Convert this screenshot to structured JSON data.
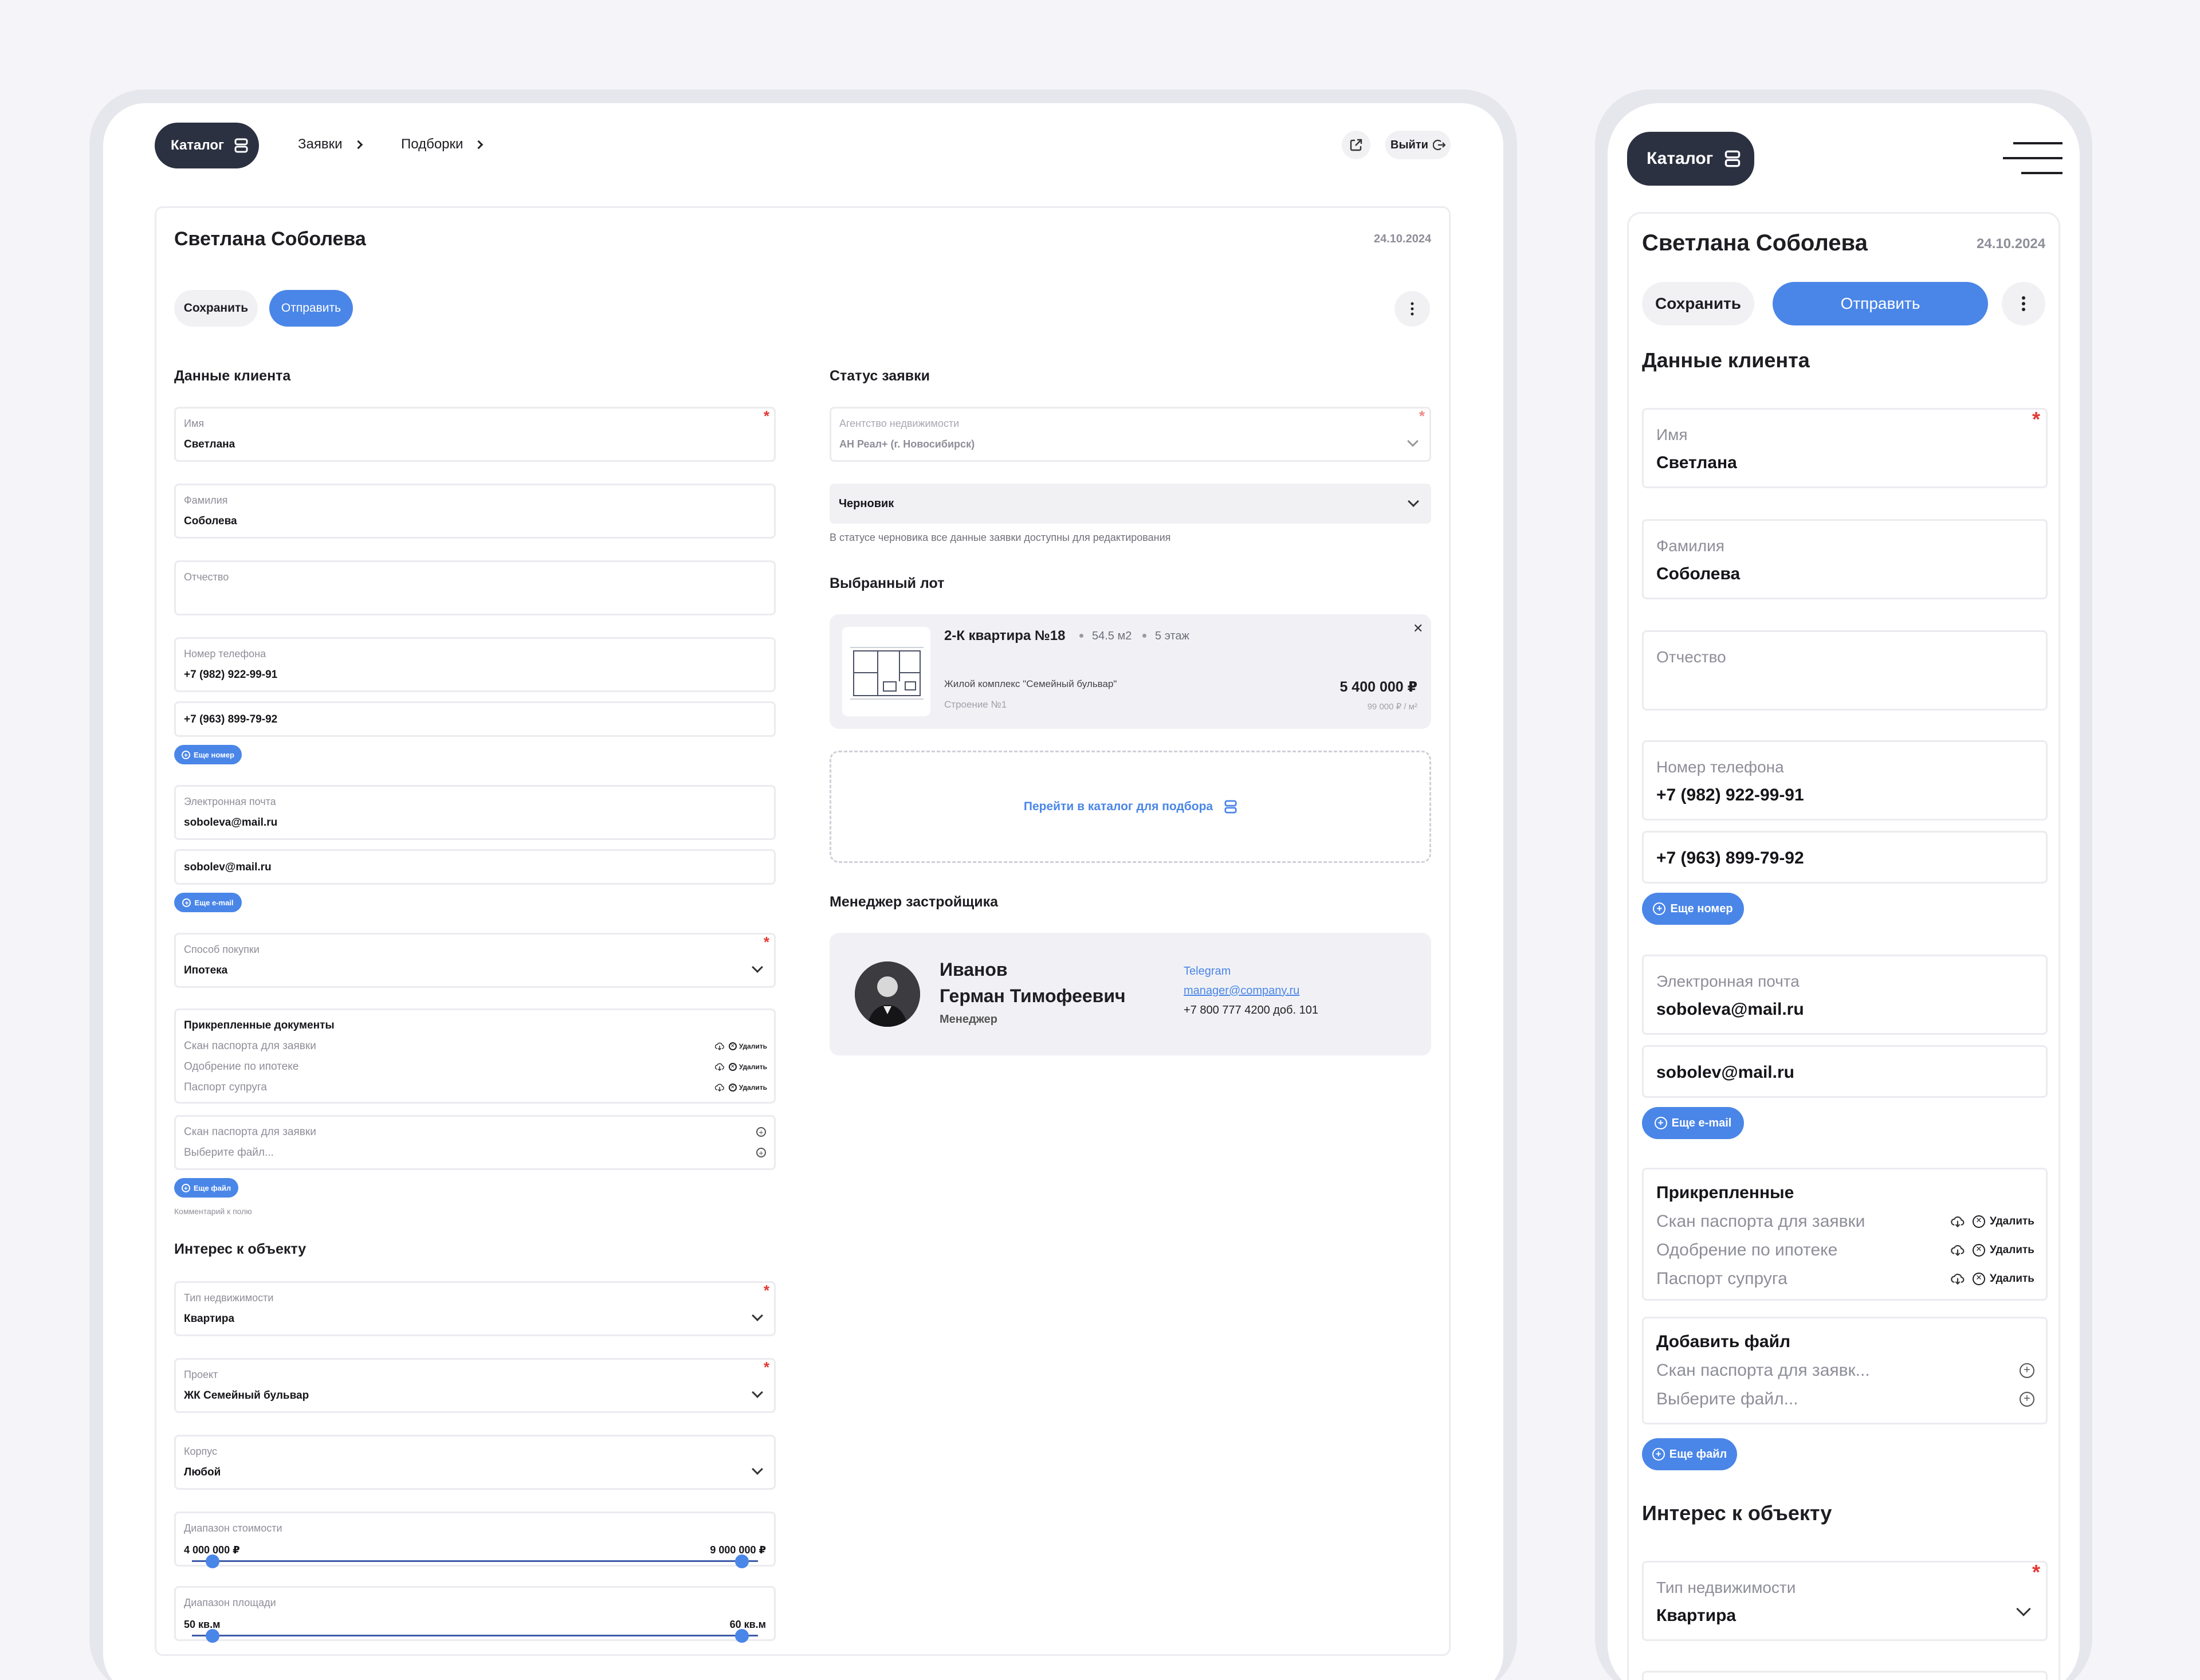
{
  "nav": {
    "catalog_label": "Каталог",
    "requests_label": "Заявки",
    "selections_label": "Подборки",
    "logout_label": "Выйти"
  },
  "header": {
    "client_name": "Светлана Соболева",
    "date": "24.10.2024",
    "save_label": "Сохранить",
    "send_label": "Отправить"
  },
  "client": {
    "section_title": "Данные клиента",
    "first_name_label": "Имя",
    "first_name_value": "Светлана",
    "last_name_label": "Фамилия",
    "last_name_value": "Соболева",
    "middle_name_label": "Отчество",
    "phone_label": "Номер телефона",
    "phone_1": "+7 (982) 922-99-91",
    "phone_2": "+7 (963) 899-79-92",
    "add_phone_label": "Еще номер",
    "email_label": "Электронная почта",
    "email_1": "soboleva@mail.ru",
    "email_2": "sobolev@mail.ru",
    "add_email_label": "Еще e-mail",
    "purchase_label": "Способ покупки",
    "purchase_value": "Ипотека",
    "docs_title": "Прикрепленные документы",
    "docs_title_mobile": "Прикрепленные",
    "docs": [
      "Скан паспорта для заявки",
      "Одобрение по ипотеке",
      "Паспорт супруга"
    ],
    "delete_label": "Удалить",
    "add_file_title": "Добавить файл",
    "new_file_1": "Скан паспорта для заявки",
    "new_file_1_mobile": "Скан паспорта для заявк...",
    "new_file_2": "Выберите файл...",
    "add_file_label": "Еще файл",
    "comment_hint": "Комментарий к полю"
  },
  "interest": {
    "section_title": "Интерес к объекту",
    "type_label": "Тип недвижимости",
    "type_value": "Квартира",
    "project_label": "Проект",
    "project_value": "ЖК Семейный бульвар",
    "building_label": "Корпус",
    "building_value": "Любой",
    "price_label": "Диапазон стоимости",
    "price_min": "4 000 000 ₽",
    "price_max": "9 000 000 ₽",
    "area_label": "Диапазон площади",
    "area_min": "50 кв.м",
    "area_max": "60 кв.м"
  },
  "status": {
    "section_title": "Статус заявки",
    "agency_label": "Агентство недвижимости",
    "agency_value": "АН Реал+ (г. Новосибирск)",
    "status_value": "Черновик",
    "status_hint": "В статусе черновика все данные заявки доступны для редактирования"
  },
  "lot": {
    "section_title": "Выбранный лот",
    "title": "2-К квартира №18",
    "area": "54.5 м2",
    "floor": "5 этаж",
    "complex": "Жилой комплекс \"Семейный бульвар\"",
    "building": "Строение №1",
    "price": "5 400 000 ₽",
    "price_per_m": "99 000 ₽ / м²",
    "catalog_link": "Перейти в каталог для подбора"
  },
  "manager": {
    "section_title": "Менеджер застройщика",
    "name_line1": "Иванов",
    "name_line2": "Герман Тимофеевич",
    "role": "Менеджер",
    "telegram": "Telegram",
    "email": "manager@company.ru",
    "phone": "+7 800 777 4200 доб. 101"
  },
  "colors": {
    "accent": "#4a86e8",
    "dark": "#2c3141",
    "required": "#e53935"
  }
}
